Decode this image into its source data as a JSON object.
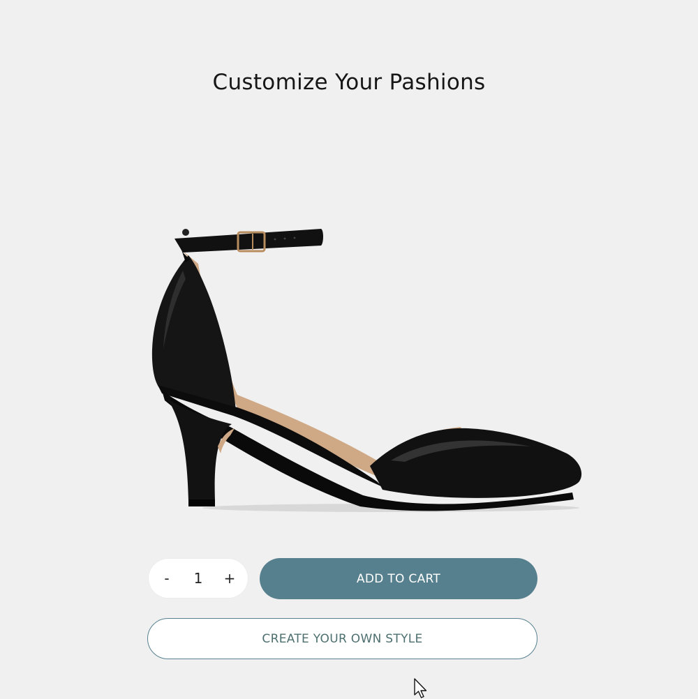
{
  "header": {
    "title": "Customize Your Pashions"
  },
  "product": {
    "image_icon": "black-ankle-strap-heel-pump"
  },
  "quantity": {
    "decrement_label": "-",
    "value": "1",
    "increment_label": "+"
  },
  "actions": {
    "add_to_cart_label": "ADD TO CART",
    "create_style_label": "CREATE YOUR OWN STYLE"
  },
  "colors": {
    "background": "#f0f0f0",
    "accent": "#57808f",
    "outline_text": "#4d6f6f"
  },
  "cursor": {
    "icon": "mouse-pointer-icon"
  }
}
